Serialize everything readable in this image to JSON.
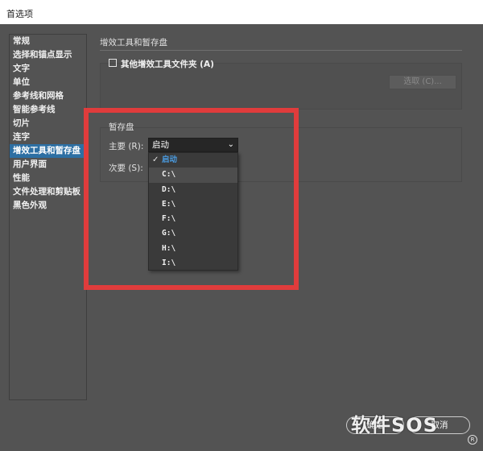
{
  "window": {
    "title": "首选项"
  },
  "sidebar": {
    "items": [
      {
        "label": "常规"
      },
      {
        "label": "选择和锚点显示"
      },
      {
        "label": "文字"
      },
      {
        "label": "单位"
      },
      {
        "label": "参考线和网格"
      },
      {
        "label": "智能参考线"
      },
      {
        "label": "切片"
      },
      {
        "label": "连字"
      },
      {
        "label": "增效工具和暂存盘",
        "selected": true
      },
      {
        "label": "用户界面"
      },
      {
        "label": "性能"
      },
      {
        "label": "文件处理和剪贴板"
      },
      {
        "label": "黑色外观"
      }
    ]
  },
  "plugins": {
    "section_title": "增效工具和暂存盘",
    "checkbox_label": "其他增效工具文件夹 (A)",
    "checkbox_checked": false,
    "choose_label": "选取 (C)..."
  },
  "scratch": {
    "title": "暂存盘",
    "primary_label": "主要 (R):",
    "primary_value": "启动",
    "secondary_label": "次要 (S):",
    "options": [
      "启动",
      "C:\\",
      "D:\\",
      "E:\\",
      "F:\\",
      "G:\\",
      "H:\\",
      "I:\\"
    ],
    "checked_option": "启动"
  },
  "footer": {
    "ok_label": "确定",
    "cancel_label": "取消"
  },
  "watermark": {
    "text": "软件SOS",
    "mark": "R"
  },
  "colors": {
    "background": "#535353",
    "selection": "#2d6fa3",
    "highlight_border": "#e03c3c",
    "checked_option": "#4a9be0"
  }
}
